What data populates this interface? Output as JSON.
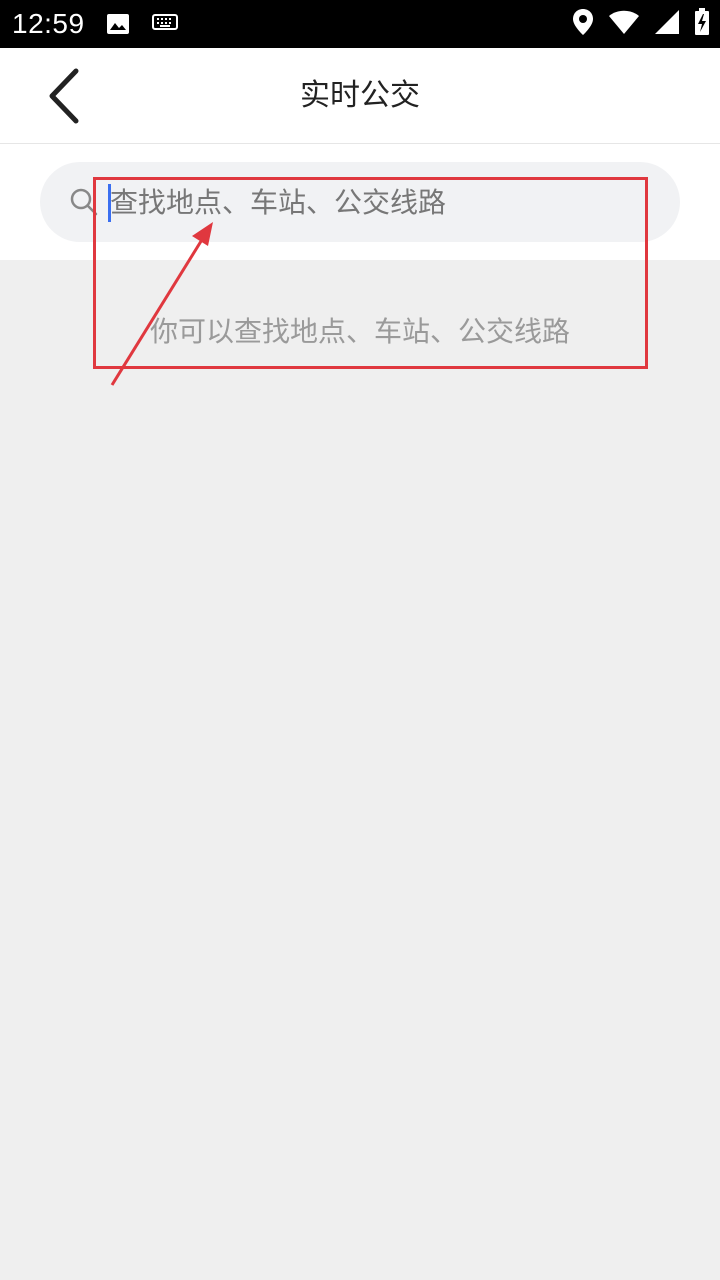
{
  "status_bar": {
    "time": "12:59",
    "left_icons": [
      "image-icon",
      "keyboard-icon"
    ],
    "right_icons": [
      "location-icon",
      "wifi-icon",
      "signal-icon",
      "battery-charging-icon"
    ]
  },
  "header": {
    "title": "实时公交",
    "back_icon": "chevron-left-icon"
  },
  "search": {
    "placeholder": "查找地点、车站、公交线路",
    "value": ""
  },
  "content": {
    "hint": "你可以查找地点、车站、公交线路"
  },
  "colors": {
    "background": "#efefef",
    "annotation_red": "#e0383f",
    "caret_blue": "#3a6ff0",
    "search_bg": "#f1f2f4"
  }
}
